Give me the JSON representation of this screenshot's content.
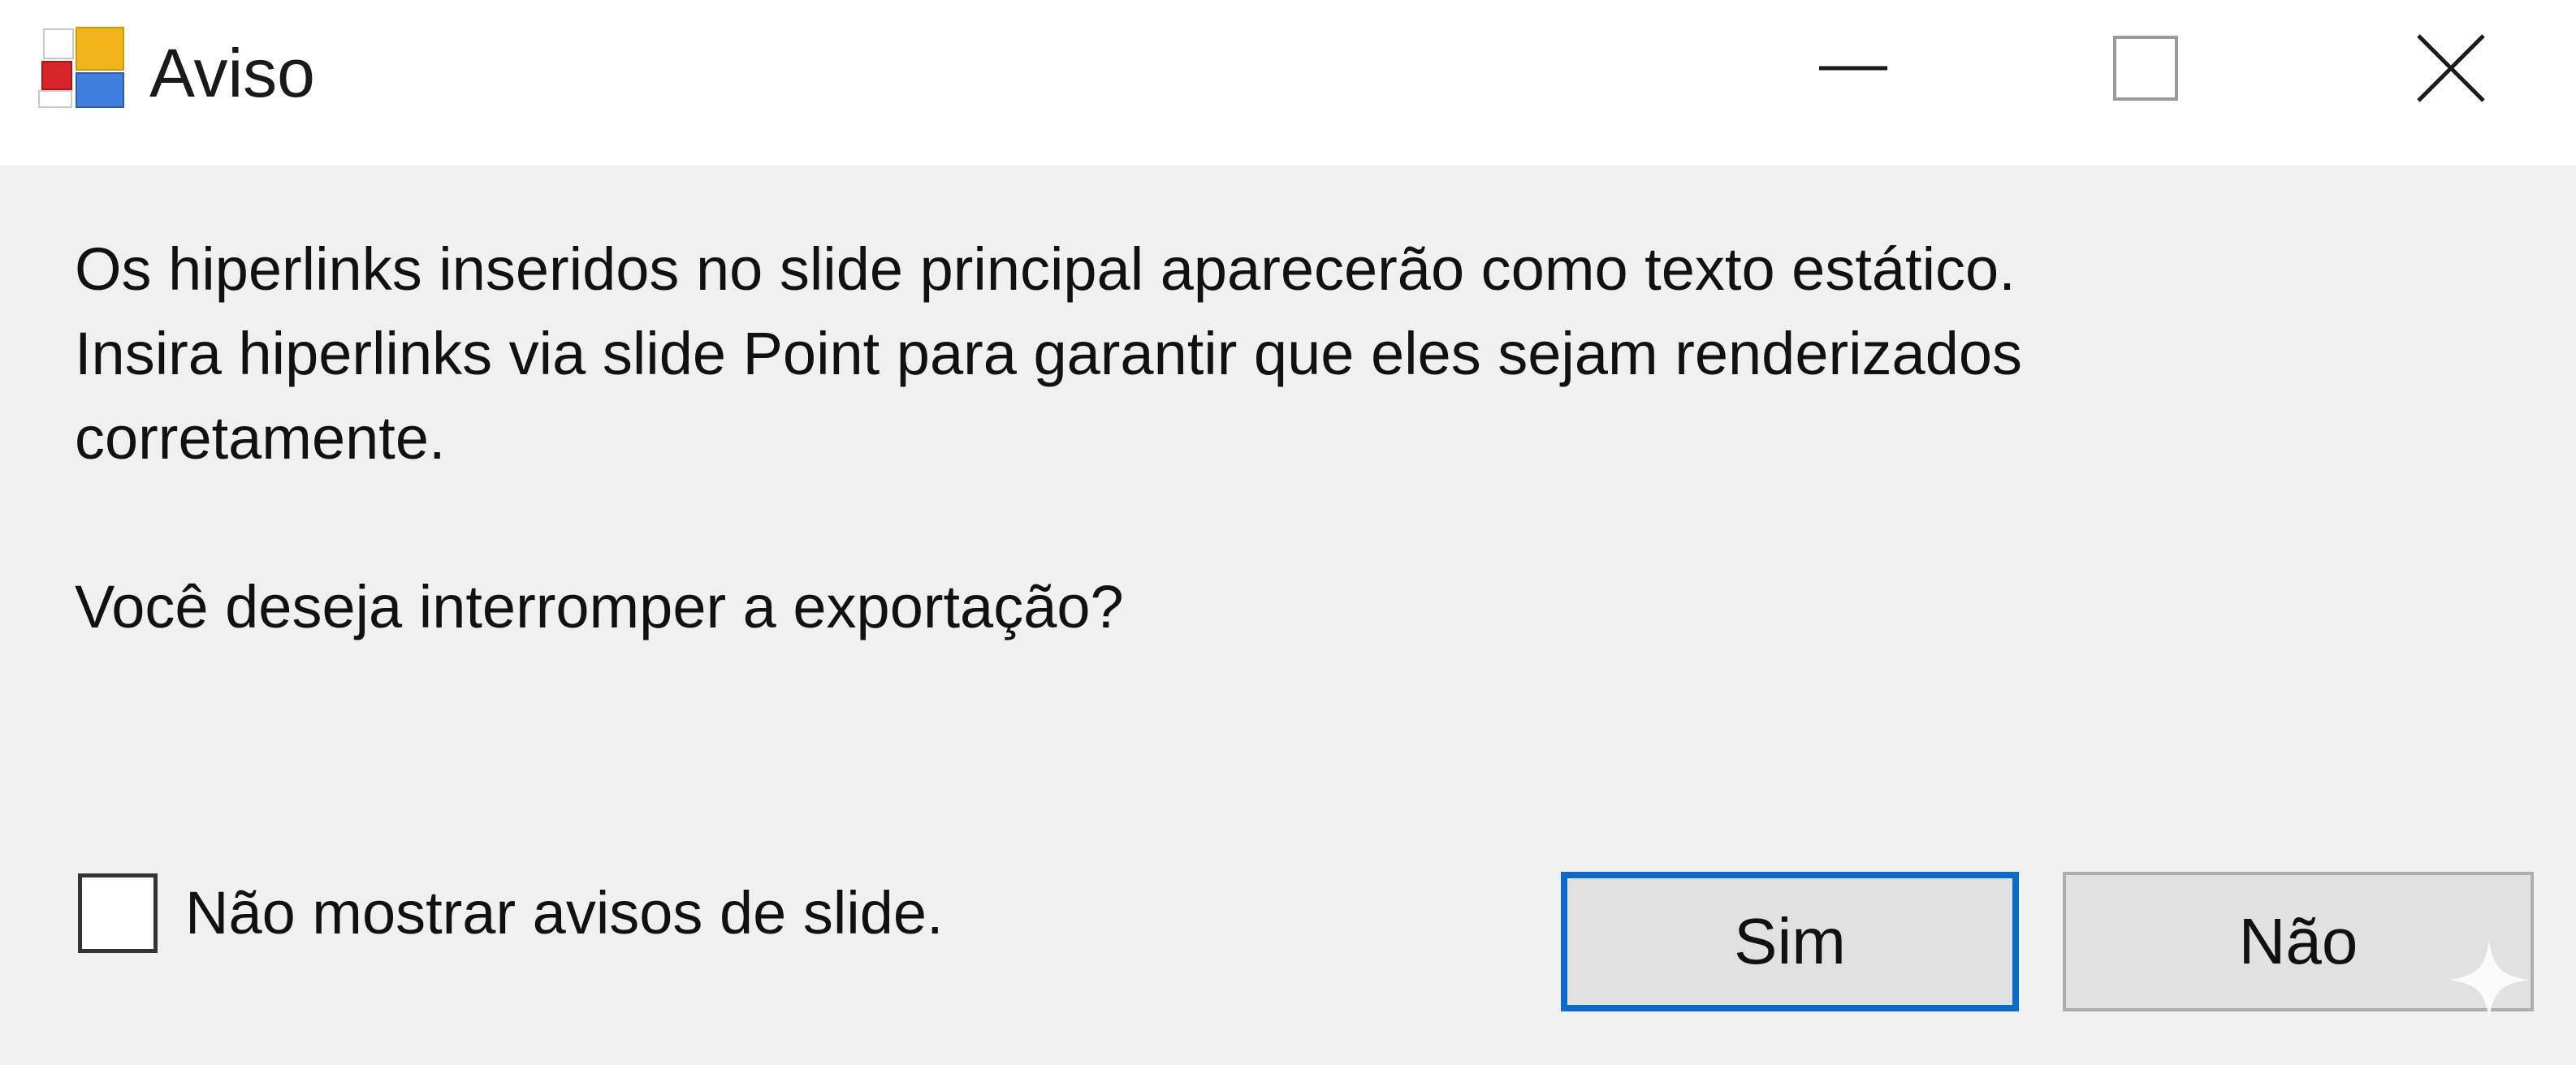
{
  "window": {
    "title": "Aviso",
    "app_icon": "app-tiles-icon",
    "controls": {
      "minimize_icon": "minimize-icon",
      "maximize_icon": "maximize-icon",
      "close_icon": "close-icon"
    }
  },
  "message": {
    "line1": "Os hiperlinks inseridos no slide principal aparecerão como texto estático.",
    "line2": "Insira hiperlinks via slide Point para garantir que eles sejam renderizados",
    "line3": "corretamente.",
    "question": "Você deseja interromper a exportação?"
  },
  "checkbox": {
    "label": "Não mostrar avisos de slide.",
    "checked": false
  },
  "buttons": {
    "yes_label": "Sim",
    "no_label": "Não"
  },
  "colors": {
    "accent": "#0a6cc8",
    "button_face": "#e1e1e1",
    "dialog_background": "#f0f0f0",
    "titlebar_background": "#ffffff"
  },
  "decorations": {
    "corner_icon": "sparkle-icon"
  }
}
